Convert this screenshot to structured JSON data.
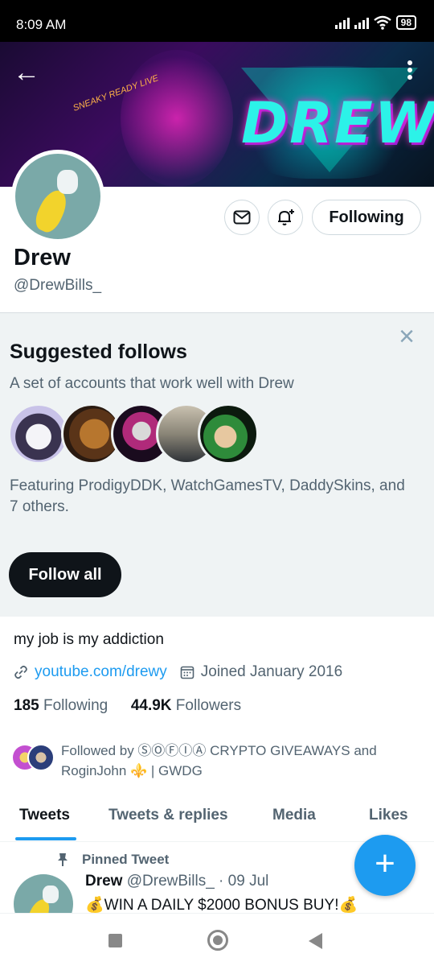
{
  "status_bar": {
    "time": "8:09 AM",
    "battery": "98"
  },
  "banner": {
    "logo_text": "DREW",
    "sign_text": "SNEAKY READY LIVE"
  },
  "header": {
    "back_label": "←"
  },
  "profile": {
    "name": "Drew",
    "handle": "@DrewBills_",
    "following_button": "Following",
    "bio": "my job is my addiction",
    "link": "youtube.com/drewy",
    "joined": "Joined January 2016",
    "following_count": "185",
    "following_label": "Following",
    "followers_count": "44.9K",
    "followers_label": "Followers",
    "followed_by": "Followed by ⓈⓄⒻⒾⒶ CRYPTO GIVEAWAYS and RoginJohn ⚜️ | GWDG"
  },
  "suggested": {
    "title": "Suggested follows",
    "subtitle": "A set of accounts that work well with Drew",
    "featuring": "Featuring ProdigyDDK, WatchGamesTV, DaddySkins, and 7 others.",
    "follow_all": "Follow all",
    "close_icon": "×"
  },
  "tabs": [
    {
      "label": "Tweets"
    },
    {
      "label": "Tweets & replies"
    },
    {
      "label": "Media"
    },
    {
      "label": "Likes"
    }
  ],
  "pinned_tweet": {
    "pinned_label": "Pinned Tweet",
    "author": "Drew",
    "handle_date": "@DrewBills_ · 09 Jul",
    "text": "💰WIN A DAILY $2000 BONUS BUY!💰"
  },
  "fab_label": "+",
  "colors": {
    "accent": "#1d9bf0",
    "text": "#0f1419",
    "muted": "#536471",
    "panel": "#eff3f4"
  }
}
